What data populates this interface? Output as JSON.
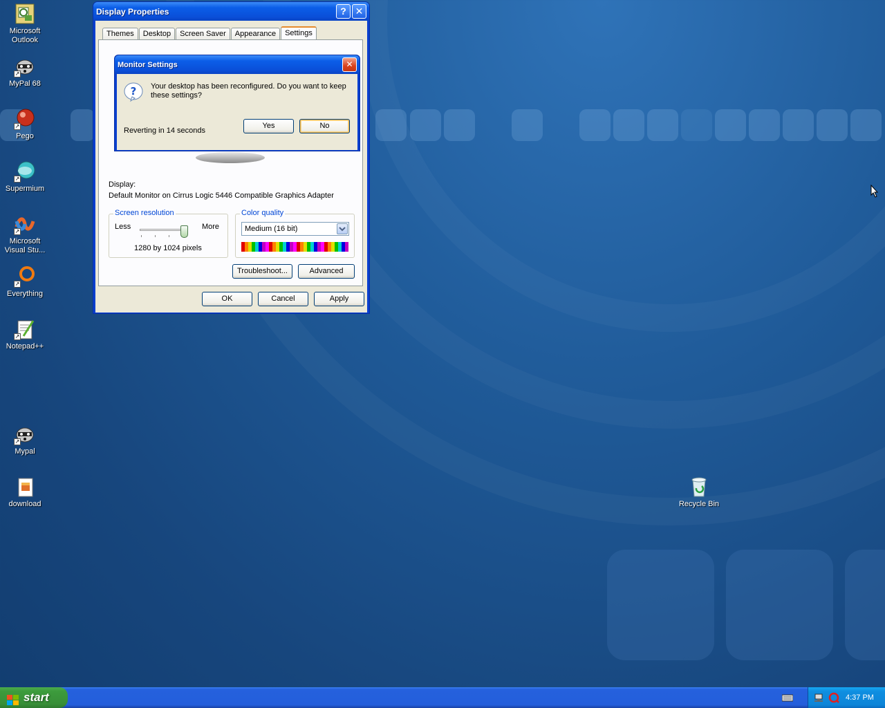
{
  "desktop": {
    "icons": [
      {
        "label": "Microsoft\nOutlook",
        "name": "outlook"
      },
      {
        "label": "MyPal 68",
        "name": "mypal-68"
      },
      {
        "label": "Pego",
        "name": "pego"
      },
      {
        "label": "Supermium",
        "name": "supermium"
      },
      {
        "label": "Microsoft\nVisual Stu...",
        "name": "visual-studio"
      },
      {
        "label": "Everything",
        "name": "everything"
      },
      {
        "label": "Notepad++",
        "name": "notepad-plus-plus"
      },
      {
        "label": "Mypal",
        "name": "mypal"
      },
      {
        "label": "download",
        "name": "download"
      },
      {
        "label": "Recycle Bin",
        "name": "recycle-bin"
      }
    ]
  },
  "display_properties": {
    "title": "Display Properties",
    "help_glyph": "?",
    "close_glyph": "✕",
    "tabs": [
      "Themes",
      "Desktop",
      "Screen Saver",
      "Appearance",
      "Settings"
    ],
    "active_tab": "Settings",
    "display_label": "Display:",
    "display_value": "Default Monitor on Cirrus Logic 5446 Compatible Graphics Adapter",
    "screen_resolution": {
      "legend": "Screen resolution",
      "less": "Less",
      "more": "More",
      "value": "1280 by 1024 pixels",
      "slider_position_fraction": 1.0
    },
    "color_quality": {
      "legend": "Color quality",
      "selected": "Medium (16 bit)"
    },
    "buttons": {
      "troubleshoot": "Troubleshoot...",
      "advanced": "Advanced",
      "ok": "OK",
      "cancel": "Cancel",
      "apply": "Apply"
    }
  },
  "monitor_settings": {
    "title": "Monitor Settings",
    "message": "Your desktop has been reconfigured.  Do you want to keep these settings?",
    "countdown": "Reverting in 14 seconds",
    "yes": "Yes",
    "no": "No"
  },
  "taskbar": {
    "start_label": "start",
    "clock": "4:37 PM"
  },
  "colors": {
    "desktop_blue": "#1f5a98",
    "xp_title_blue": "#0a4fd8",
    "start_green": "#3c9b3c",
    "close_red": "#d9411c",
    "tab_active_orange": "#e68b2c"
  }
}
